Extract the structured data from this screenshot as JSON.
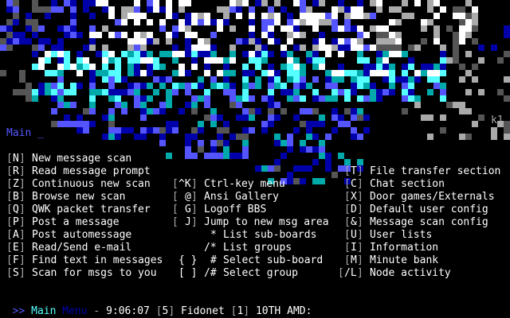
{
  "header": {
    "prompt": "Main _",
    "artist_tag": "k1"
  },
  "art": {
    "palette": {
      "blue": "#0000aa",
      "lightblue": "#5555ff",
      "cyan": "#55ffff",
      "teal": "#00aaaa",
      "white": "#ffffff",
      "gray": "#aaaaaa",
      "darkgray": "#555555"
    }
  },
  "menu": {
    "left": [
      {
        "key": "N",
        "label": "New message scan"
      },
      {
        "key": "R",
        "label": "Read message prompt"
      },
      {
        "key": "Z",
        "label": "Continuous new scan"
      },
      {
        "key": "B",
        "label": "Browse new scan"
      },
      {
        "key": "Q",
        "label": "QWK packet transfer"
      },
      {
        "key": "P",
        "label": "Post a message"
      },
      {
        "key": "A",
        "label": "Post automessage"
      },
      {
        "key": "E",
        "label": "Read/Send e-mail"
      },
      {
        "key": "F",
        "label": "Find text in messages"
      },
      {
        "key": "S",
        "label": "Scan for msgs to you"
      }
    ],
    "middle": [
      {
        "key": "^K",
        "label": "Ctrl-key menu"
      },
      {
        "key": "@",
        "label": "Ansi Gallery"
      },
      {
        "key": "G",
        "label": "Logoff BBS"
      },
      {
        "key": "J",
        "label": "Jump to new msg area"
      },
      {
        "key": "*",
        "label": "List sub-boards"
      },
      {
        "key": "/*",
        "label": "List groups"
      },
      {
        "key": "{ }",
        "key2": "#",
        "label": "Select sub-board"
      },
      {
        "key": "[ ]",
        "key2": "/#",
        "label": "Select group"
      }
    ],
    "right": [
      {
        "key": "T",
        "label": "File transfer section"
      },
      {
        "key": "C",
        "label": "Chat section"
      },
      {
        "key": "X",
        "label": "Door games/Externals"
      },
      {
        "key": "D",
        "label": "Default user config"
      },
      {
        "key": "&",
        "label": "Message scan config"
      },
      {
        "key": "U",
        "label": "User lists"
      },
      {
        "key": "I",
        "label": "Information"
      },
      {
        "key": "M",
        "label": "Minute bank"
      },
      {
        "key": "/L",
        "label": "Node activity"
      }
    ]
  },
  "status": {
    "arrows": ">>",
    "main": "Main",
    "menu": "Menu",
    "dash": "-",
    "time": "9:06:07",
    "group_num": "5",
    "group_name": "Fidonet",
    "sub_num": "1",
    "sub_name": "10TH AMD:"
  }
}
